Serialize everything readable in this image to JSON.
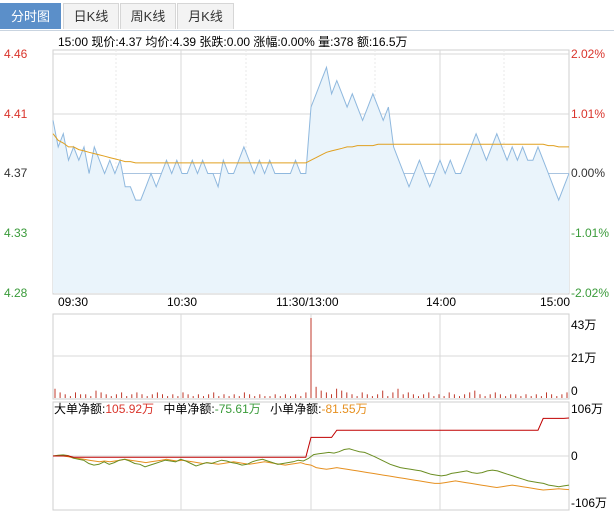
{
  "tabs": [
    {
      "label": "分时图",
      "active": true
    },
    {
      "label": "日K线",
      "active": false
    },
    {
      "label": "周K线",
      "active": false
    },
    {
      "label": "月K线",
      "active": false
    }
  ],
  "info": {
    "text": "15:00 现价:4.37 均价:4.39 张跌:0.00 涨幅:0.00% 量:378 额:16.5万"
  },
  "colors": {
    "up": "#d9342b",
    "down": "#3a9b3a",
    "price_line": "#8fb8de",
    "price_fill": "#eaf4fb",
    "avg_line": "#e0a020",
    "grid": "#d8d8d8",
    "volume": "#c0392b",
    "big": "#c00000",
    "mid": "#6b8e23",
    "small": "#e69020"
  },
  "chart_data": [
    {
      "type": "line",
      "title": "",
      "x_ticks": [
        "09:30",
        "10:30",
        "11:30/13:00",
        "14:00",
        "15:00"
      ],
      "y_left_ticks": [
        "4.46",
        "4.41",
        "4.37",
        "4.33",
        "4.28"
      ],
      "y_right_ticks": [
        "2.02%",
        "1.01%",
        "0.00%",
        "-1.01%",
        "-2.02%"
      ],
      "ylim": [
        4.28,
        4.46
      ],
      "prev_close": 4.37,
      "series": [
        {
          "name": "现价",
          "values": [
            4.41,
            4.39,
            4.4,
            4.38,
            4.39,
            4.38,
            4.39,
            4.37,
            4.39,
            4.38,
            4.37,
            4.38,
            4.37,
            4.38,
            4.36,
            4.36,
            4.35,
            4.35,
            4.36,
            4.37,
            4.36,
            4.37,
            4.38,
            4.37,
            4.38,
            4.37,
            4.37,
            4.38,
            4.37,
            4.38,
            4.37,
            4.37,
            4.36,
            4.38,
            4.37,
            4.37,
            4.38,
            4.39,
            4.38,
            4.37,
            4.38,
            4.37,
            4.38,
            4.37,
            4.37,
            4.37,
            4.37,
            4.38,
            4.37,
            4.37,
            4.42,
            4.43,
            4.44,
            4.45,
            4.43,
            4.44,
            4.43,
            4.42,
            4.43,
            4.42,
            4.41,
            4.42,
            4.43,
            4.42,
            4.41,
            4.42,
            4.39,
            4.38,
            4.37,
            4.36,
            4.37,
            4.38,
            4.37,
            4.36,
            4.37,
            4.38,
            4.37,
            4.38,
            4.37,
            4.37,
            4.38,
            4.39,
            4.4,
            4.39,
            4.38,
            4.39,
            4.4,
            4.39,
            4.38,
            4.39,
            4.38,
            4.39,
            4.38,
            4.38,
            4.39,
            4.38,
            4.37,
            4.36,
            4.35,
            4.36,
            4.37
          ]
        },
        {
          "name": "均价",
          "values": [
            4.4,
            4.395,
            4.393,
            4.39,
            4.39,
            4.388,
            4.387,
            4.386,
            4.385,
            4.384,
            4.383,
            4.382,
            4.381,
            4.38,
            4.379,
            4.379,
            4.378,
            4.378,
            4.378,
            4.378,
            4.378,
            4.378,
            4.378,
            4.378,
            4.378,
            4.378,
            4.378,
            4.378,
            4.378,
            4.378,
            4.378,
            4.378,
            4.378,
            4.378,
            4.378,
            4.378,
            4.378,
            4.378,
            4.378,
            4.378,
            4.378,
            4.378,
            4.378,
            4.378,
            4.378,
            4.378,
            4.378,
            4.378,
            4.378,
            4.378,
            4.38,
            4.382,
            4.384,
            4.386,
            4.387,
            4.388,
            4.389,
            4.39,
            4.39,
            4.391,
            4.391,
            4.391,
            4.391,
            4.392,
            4.392,
            4.392,
            4.392,
            4.392,
            4.392,
            4.392,
            4.392,
            4.392,
            4.392,
            4.392,
            4.392,
            4.392,
            4.392,
            4.392,
            4.392,
            4.392,
            4.392,
            4.392,
            4.392,
            4.392,
            4.392,
            4.392,
            4.392,
            4.392,
            4.392,
            4.392,
            4.392,
            4.392,
            4.392,
            4.392,
            4.392,
            4.392,
            4.391,
            4.391,
            4.39,
            4.39,
            4.39
          ]
        }
      ]
    },
    {
      "type": "bar",
      "title": "",
      "y_ticks": [
        "43万",
        "21万",
        "0"
      ],
      "ylim": [
        0,
        43
      ],
      "values": [
        5,
        3,
        2,
        1,
        3,
        2,
        2,
        1,
        4,
        3,
        2,
        1,
        2,
        3,
        1,
        2,
        3,
        2,
        1,
        2,
        3,
        2,
        1,
        2,
        1,
        3,
        2,
        1,
        2,
        1,
        2,
        3,
        1,
        2,
        1,
        2,
        1,
        3,
        2,
        1,
        2,
        1,
        1,
        2,
        1,
        2,
        1,
        2,
        1,
        3,
        43,
        6,
        4,
        3,
        2,
        5,
        4,
        3,
        2,
        1,
        3,
        2,
        1,
        2,
        4,
        1,
        3,
        5,
        2,
        3,
        2,
        1,
        2,
        3,
        1,
        2,
        1,
        3,
        2,
        1,
        2,
        3,
        4,
        2,
        1,
        2,
        3,
        2,
        1,
        2,
        2,
        1,
        2,
        1,
        2,
        1,
        3,
        2,
        1,
        2,
        3
      ]
    },
    {
      "type": "line",
      "title": "",
      "legend": [
        {
          "label": "大单净额:",
          "value": "105.92万"
        },
        {
          "label": "中单净额:",
          "value": "-75.61万"
        },
        {
          "label": "小单净额:",
          "value": "-81.55万"
        }
      ],
      "y_ticks": [
        "106万",
        "0",
        "-106万"
      ],
      "ylim": [
        -106,
        106
      ],
      "series": [
        {
          "name": "大单净额",
          "values": [
            0,
            0,
            0,
            0,
            -3,
            -3,
            -3,
            -3,
            -3,
            -3,
            -3,
            -3,
            -3,
            -3,
            -3,
            -3,
            -3,
            -3,
            -3,
            -3,
            -3,
            -3,
            -3,
            -3,
            -3,
            -3,
            -3,
            -3,
            -3,
            -3,
            -3,
            -3,
            -3,
            -3,
            -3,
            -3,
            -3,
            -3,
            -3,
            -3,
            -3,
            -3,
            -3,
            -3,
            -3,
            -3,
            -3,
            -3,
            -3,
            -3,
            52,
            52,
            52,
            52,
            52,
            72,
            72,
            72,
            72,
            72,
            72,
            72,
            72,
            72,
            72,
            72,
            72,
            72,
            72,
            72,
            72,
            72,
            72,
            72,
            72,
            72,
            72,
            72,
            72,
            72,
            72,
            72,
            72,
            72,
            72,
            72,
            72,
            72,
            72,
            72,
            72,
            72,
            72,
            72,
            72,
            105,
            105,
            105,
            105,
            105,
            106
          ]
        },
        {
          "name": "中单净额",
          "values": [
            0,
            2,
            3,
            1,
            -5,
            -8,
            -10,
            -18,
            -22,
            -20,
            -14,
            -20,
            -16,
            -10,
            -8,
            -12,
            -18,
            -20,
            -26,
            -22,
            -18,
            -14,
            -10,
            -12,
            -14,
            -8,
            -12,
            -18,
            -24,
            -20,
            -16,
            -18,
            -14,
            -10,
            -12,
            -16,
            -18,
            -22,
            -20,
            -14,
            -10,
            -8,
            -12,
            -16,
            -20,
            -18,
            -16,
            -14,
            -10,
            -12,
            -6,
            4,
            6,
            8,
            10,
            8,
            12,
            18,
            20,
            16,
            12,
            10,
            4,
            -2,
            -8,
            -14,
            -20,
            -24,
            -28,
            -30,
            -32,
            -34,
            -36,
            -40,
            -44,
            -46,
            -48,
            -46,
            -42,
            -40,
            -38,
            -36,
            -40,
            -42,
            -40,
            -36,
            -34,
            -36,
            -40,
            -44,
            -48,
            -52,
            -56,
            -60,
            -62,
            -64,
            -66,
            -70,
            -72,
            -74,
            -72,
            -70
          ]
        },
        {
          "name": "小单净额",
          "values": [
            0,
            1,
            0,
            -2,
            -5,
            -6,
            -8,
            -10,
            -12,
            -14,
            -12,
            -14,
            -12,
            -10,
            -8,
            -10,
            -12,
            -14,
            -16,
            -14,
            -12,
            -10,
            -8,
            -10,
            -12,
            -10,
            -12,
            -14,
            -16,
            -18,
            -16,
            -18,
            -20,
            -18,
            -16,
            -14,
            -16,
            -18,
            -20,
            -18,
            -16,
            -14,
            -16,
            -18,
            -20,
            -22,
            -20,
            -18,
            -16,
            -20,
            -22,
            -28,
            -30,
            -32,
            -30,
            -28,
            -30,
            -32,
            -34,
            -36,
            -38,
            -40,
            -42,
            -44,
            -46,
            -48,
            -50,
            -52,
            -54,
            -56,
            -58,
            -60,
            -62,
            -64,
            -66,
            -66,
            -64,
            -62,
            -60,
            -62,
            -64,
            -66,
            -68,
            -70,
            -72,
            -74,
            -76,
            -74,
            -72,
            -70,
            -72,
            -74,
            -76,
            -78,
            -80,
            -82,
            -81,
            -80,
            -79,
            -80,
            -81
          ]
        }
      ]
    }
  ]
}
